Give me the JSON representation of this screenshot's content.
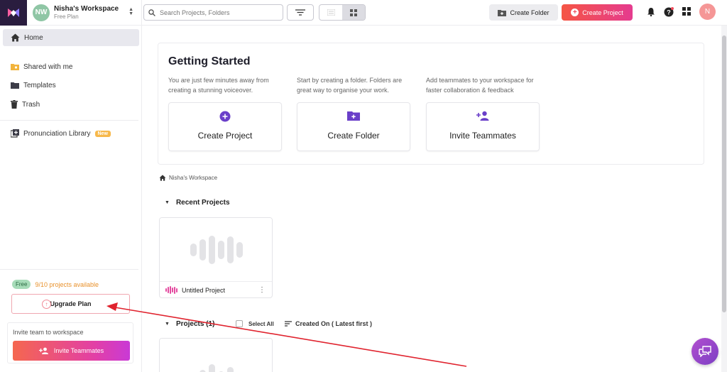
{
  "workspace": {
    "initials": "NW",
    "name": "Nisha's Workspace",
    "plan": "Free Plan"
  },
  "sidebar": {
    "items": [
      {
        "label": "Home",
        "icon": "home-icon"
      },
      {
        "label": "Shared with me",
        "icon": "shared-folder-icon"
      },
      {
        "label": "Templates",
        "icon": "folder-icon"
      },
      {
        "label": "Trash",
        "icon": "trash-icon"
      },
      {
        "label": "Pronunciation Library",
        "icon": "library-add-icon",
        "badge": "New"
      }
    ],
    "plan_badge": "Free",
    "projects_available": "9/10 projects available",
    "upgrade_label": "Upgrade Plan",
    "invite_prompt": "Invite team to workspace",
    "invite_button": "Invite Teammates"
  },
  "topbar": {
    "search_placeholder": "Search Projects, Folders",
    "create_folder": "Create Folder",
    "create_project": "Create Project",
    "user_initial": "N"
  },
  "getting_started": {
    "title": "Getting Started",
    "columns": [
      {
        "description": "You are just few minutes away from creating a stunning voiceover.",
        "card_label": "Create Project",
        "icon": "add-circle-icon"
      },
      {
        "description": "Start by creating a folder. Folders are great way to organise your work.",
        "card_label": "Create Folder",
        "icon": "new-folder-icon"
      },
      {
        "description": "Add teammates to your workspace for faster collaboration & feedback",
        "card_label": "Invite Teammates",
        "icon": "add-person-icon"
      }
    ]
  },
  "breadcrumb": {
    "label": "Nisha's Workspace"
  },
  "recent_projects": {
    "heading": "Recent Projects",
    "items": [
      {
        "name": "Untitled Project"
      }
    ]
  },
  "projects": {
    "heading": "Projects (1)",
    "select_all": "Select All",
    "sort_label": "Created On ( Latest first )"
  },
  "colors": {
    "accent_gradient_start": "#f55544",
    "accent_gradient_end": "#e53b8f",
    "icon_purple": "#6a3fc9",
    "annotation_arrow": "#e0232e"
  }
}
